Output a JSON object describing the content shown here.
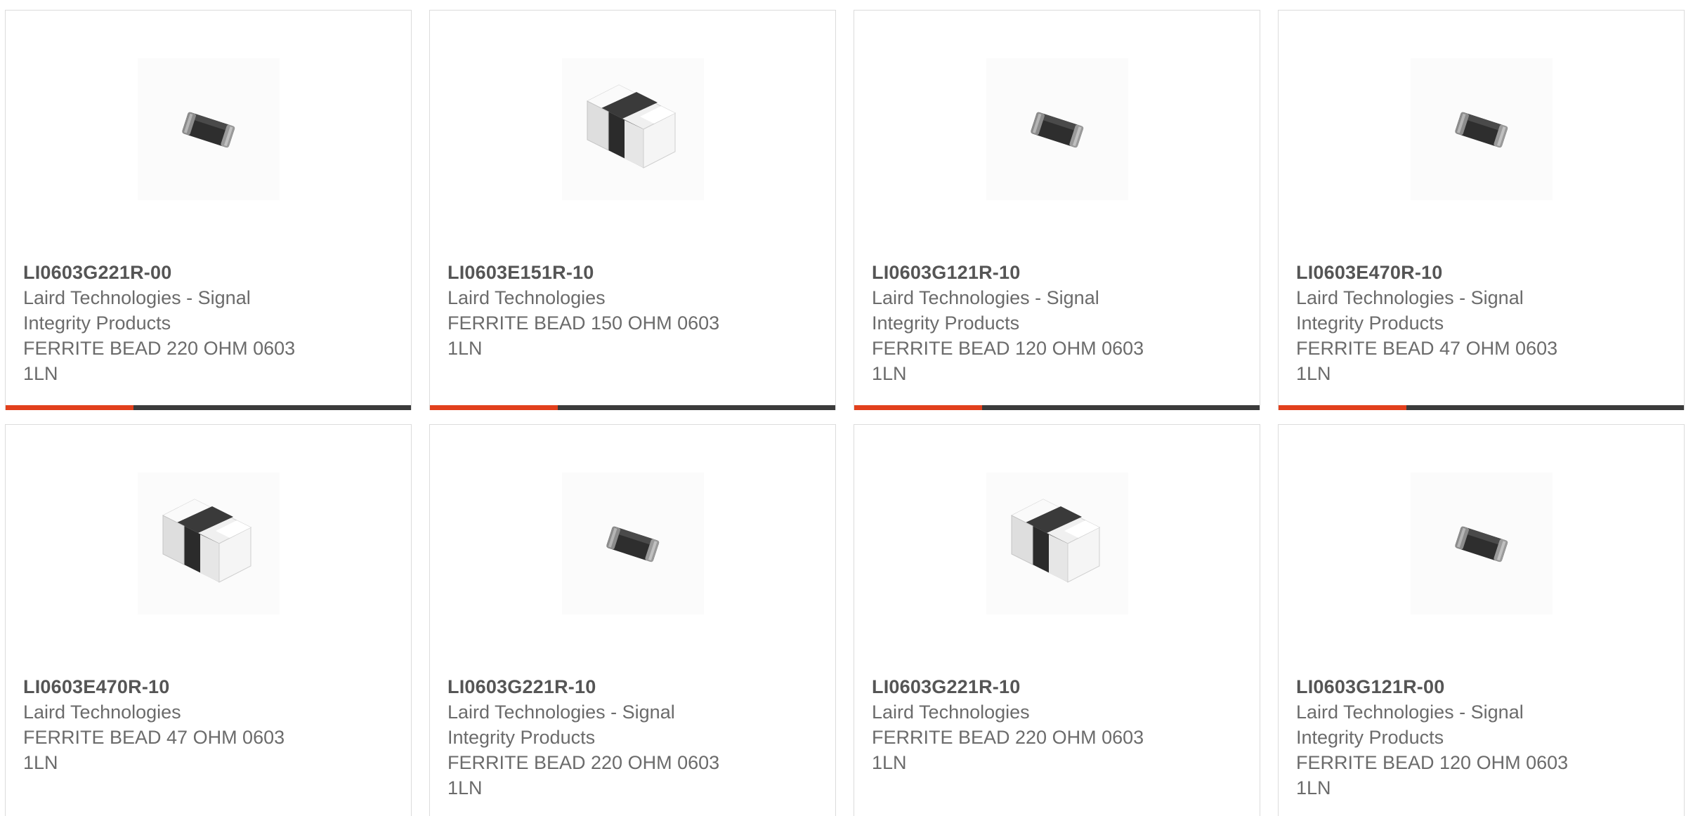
{
  "colors": {
    "accent": "#e2401c",
    "bar": "#3b3b3b",
    "border": "#dcdcdc",
    "text": "#6b6b6b",
    "title": "#555555"
  },
  "products": [
    {
      "part_number": "LI0603G221R-00",
      "manufacturer": "Laird Technologies - Signal Integrity Products",
      "description": "FERRITE BEAD 220 OHM 0603 1LN",
      "image_icon": "smd-ferrite-bead-small-icon"
    },
    {
      "part_number": "LI0603E151R-10",
      "manufacturer": "Laird Technologies",
      "description": "FERRITE BEAD 150 OHM 0603 1LN",
      "image_icon": "smd-ferrite-bead-large-icon"
    },
    {
      "part_number": "LI0603G121R-10",
      "manufacturer": "Laird Technologies - Signal Integrity Products",
      "description": "FERRITE BEAD 120 OHM 0603 1LN",
      "image_icon": "smd-ferrite-bead-small-icon"
    },
    {
      "part_number": "LI0603E470R-10",
      "manufacturer": "Laird Technologies - Signal Integrity Products",
      "description": "FERRITE BEAD 47 OHM 0603 1LN",
      "image_icon": "smd-ferrite-bead-small-icon"
    },
    {
      "part_number": "LI0603E470R-10",
      "manufacturer": "Laird Technologies",
      "description": "FERRITE BEAD 47 OHM 0603 1LN",
      "image_icon": "smd-ferrite-bead-large-icon"
    },
    {
      "part_number": "LI0603G221R-10",
      "manufacturer": "Laird Technologies - Signal Integrity Products",
      "description": "FERRITE BEAD 220 OHM 0603 1LN",
      "image_icon": "smd-ferrite-bead-small-icon"
    },
    {
      "part_number": "LI0603G221R-10",
      "manufacturer": "Laird Technologies",
      "description": "FERRITE BEAD 220 OHM 0603 1LN",
      "image_icon": "smd-ferrite-bead-large-icon"
    },
    {
      "part_number": "LI0603G121R-00",
      "manufacturer": "Laird Technologies - Signal Integrity Products",
      "description": "FERRITE BEAD 120 OHM 0603 1LN",
      "image_icon": "smd-ferrite-bead-small-icon"
    }
  ]
}
